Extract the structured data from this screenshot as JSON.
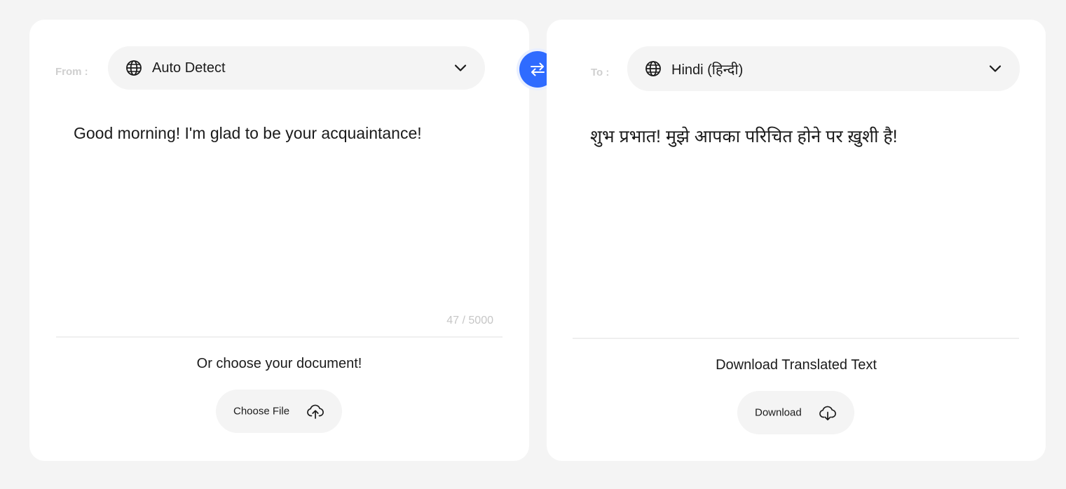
{
  "source": {
    "label": "From :",
    "language": "Auto Detect",
    "globe_icon": "globe-icon",
    "dropdown_icon": "chevron-down-icon",
    "text": "Good morning! I'm glad to be your acquaintance!",
    "char_count": "47 / 5000",
    "document_prompt": "Or choose your document!",
    "choose_file_label": "Choose File",
    "upload_icon": "cloud-upload-icon"
  },
  "swap": {
    "icon": "swap-arrows-icon",
    "color": "#2f6bff"
  },
  "target": {
    "label": "To :",
    "language": "Hindi (हिन्दी)",
    "globe_icon": "globe-icon",
    "dropdown_icon": "chevron-down-icon",
    "text": "शुभ प्रभात! मुझे आपका परिचित होने पर ख़ुशी है!",
    "download_prompt": "Download Translated Text",
    "download_label": "Download",
    "download_icon": "cloud-download-icon"
  }
}
